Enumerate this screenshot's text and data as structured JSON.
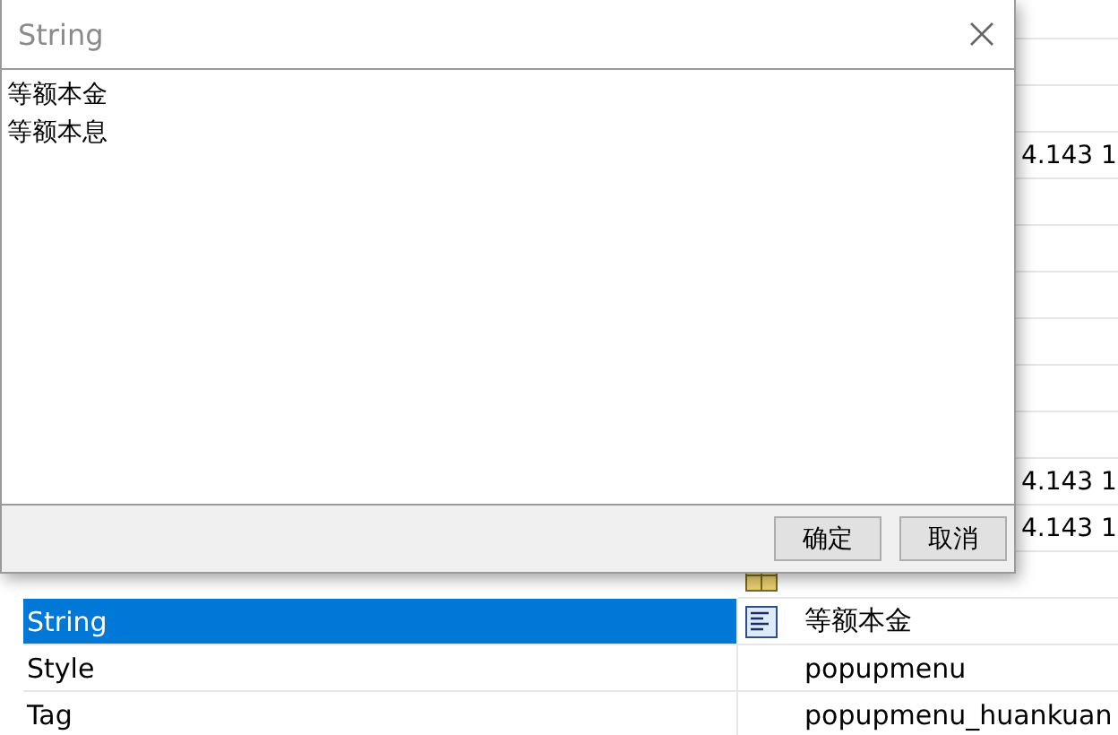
{
  "inspector": {
    "rows": [
      {},
      {},
      {},
      {
        "value": "4.143 1"
      },
      {},
      {},
      {},
      {},
      {},
      {},
      {
        "value": "4.143 1"
      },
      {
        "value": "4.143 1"
      },
      {
        "kind": "array"
      },
      {
        "kind": "text",
        "name": "String",
        "value": "等额本金",
        "selected": true
      },
      {
        "kind": "plain",
        "name": "Style",
        "value": "popupmenu",
        "selected": false
      },
      {
        "kind": "plain",
        "name": "Tag",
        "value": "popupmenu_huankuan",
        "selected": false
      }
    ]
  },
  "dialog": {
    "title": "String",
    "lines": [
      "等额本金",
      "等额本息"
    ],
    "buttons": [
      "确定",
      "取消"
    ]
  }
}
